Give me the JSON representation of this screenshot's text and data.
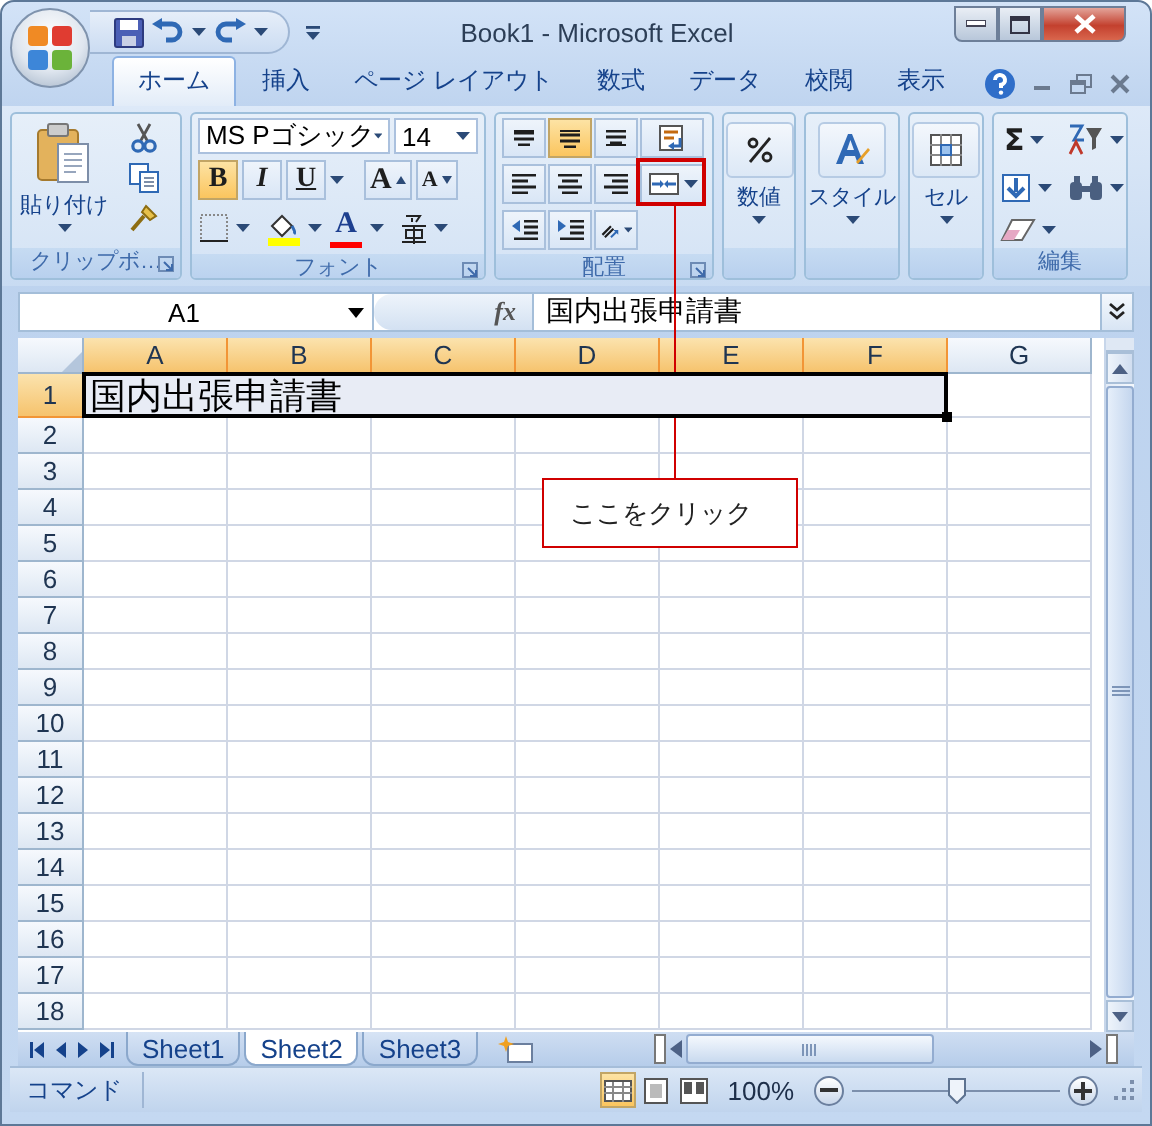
{
  "window": {
    "title": "Book1 - Microsoft Excel"
  },
  "tabs": [
    {
      "label": "ホーム",
      "selected": true
    },
    {
      "label": "挿入",
      "selected": false
    },
    {
      "label": "ページ レイアウト",
      "selected": false
    },
    {
      "label": "数式",
      "selected": false
    },
    {
      "label": "データ",
      "selected": false
    },
    {
      "label": "校閲",
      "selected": false
    },
    {
      "label": "表示",
      "selected": false
    }
  ],
  "ribbon": {
    "clipboard": {
      "paste_label": "貼り付け",
      "group_label": "クリップボ…"
    },
    "font": {
      "name": "MS Pゴシック",
      "size": "14",
      "styles": [
        {
          "kind": "bold",
          "label": "B",
          "selected": true
        },
        {
          "kind": "italic",
          "label": "I",
          "selected": false
        },
        {
          "kind": "underline",
          "label": "U",
          "selected": false
        }
      ],
      "grow_label": "A",
      "shrink_label": "A",
      "color_label": "A",
      "group_label": "フォント"
    },
    "alignment": {
      "buttons": [
        {
          "kind": "top",
          "selected": false
        },
        {
          "kind": "middle",
          "selected": true
        },
        {
          "kind": "bottom",
          "selected": false
        },
        {
          "kind": "wrap",
          "selected": false
        },
        {
          "kind": "left",
          "selected": false
        },
        {
          "kind": "center",
          "selected": false
        },
        {
          "kind": "right",
          "selected": false
        },
        {
          "kind": "merge",
          "selected": false
        },
        {
          "kind": "outdent",
          "selected": false
        },
        {
          "kind": "indent",
          "selected": false
        },
        {
          "kind": "orientation",
          "selected": false
        }
      ],
      "group_label": "配置"
    },
    "number": {
      "label": "数値"
    },
    "styles": {
      "label": "スタイル"
    },
    "cells": {
      "label": "セル"
    },
    "editing": {
      "sum_label": "Σ",
      "group_label": "編集"
    }
  },
  "formula_bar": {
    "name_box": "A1",
    "function_label": "fx",
    "value": "国内出張申請書"
  },
  "grid": {
    "columns": [
      {
        "label": "A",
        "selected": true
      },
      {
        "label": "B",
        "selected": true
      },
      {
        "label": "C",
        "selected": true
      },
      {
        "label": "D",
        "selected": true
      },
      {
        "label": "E",
        "selected": true
      },
      {
        "label": "F",
        "selected": true
      },
      {
        "label": "G",
        "selected": false
      }
    ],
    "rows": [
      {
        "label": "1",
        "selected": true,
        "cells": [
          "国内出張申請書"
        ]
      },
      {
        "label": "2",
        "selected": false
      },
      {
        "label": "3",
        "selected": false
      },
      {
        "label": "4",
        "selected": false
      },
      {
        "label": "5",
        "selected": false
      },
      {
        "label": "6",
        "selected": false
      },
      {
        "label": "7",
        "selected": false
      },
      {
        "label": "8",
        "selected": false
      },
      {
        "label": "9",
        "selected": false
      },
      {
        "label": "10",
        "selected": false
      },
      {
        "label": "11",
        "selected": false
      },
      {
        "label": "12",
        "selected": false
      },
      {
        "label": "13",
        "selected": false
      },
      {
        "label": "14",
        "selected": false
      },
      {
        "label": "15",
        "selected": false
      },
      {
        "label": "16",
        "selected": false
      },
      {
        "label": "17",
        "selected": false
      },
      {
        "label": "18",
        "selected": false
      }
    ]
  },
  "sheet_tabs": [
    {
      "label": "Sheet1",
      "selected": false
    },
    {
      "label": "Sheet2",
      "selected": true
    },
    {
      "label": "Sheet3",
      "selected": false
    }
  ],
  "status_bar": {
    "mode": "コマンド",
    "views": [
      {
        "kind": "normal",
        "selected": true
      },
      {
        "kind": "page_layout",
        "selected": false
      },
      {
        "kind": "page_break",
        "selected": false
      }
    ],
    "zoom": "100%",
    "zoom_slider": {
      "level": 0.5
    }
  },
  "callout": {
    "text": "ここをクリック"
  }
}
